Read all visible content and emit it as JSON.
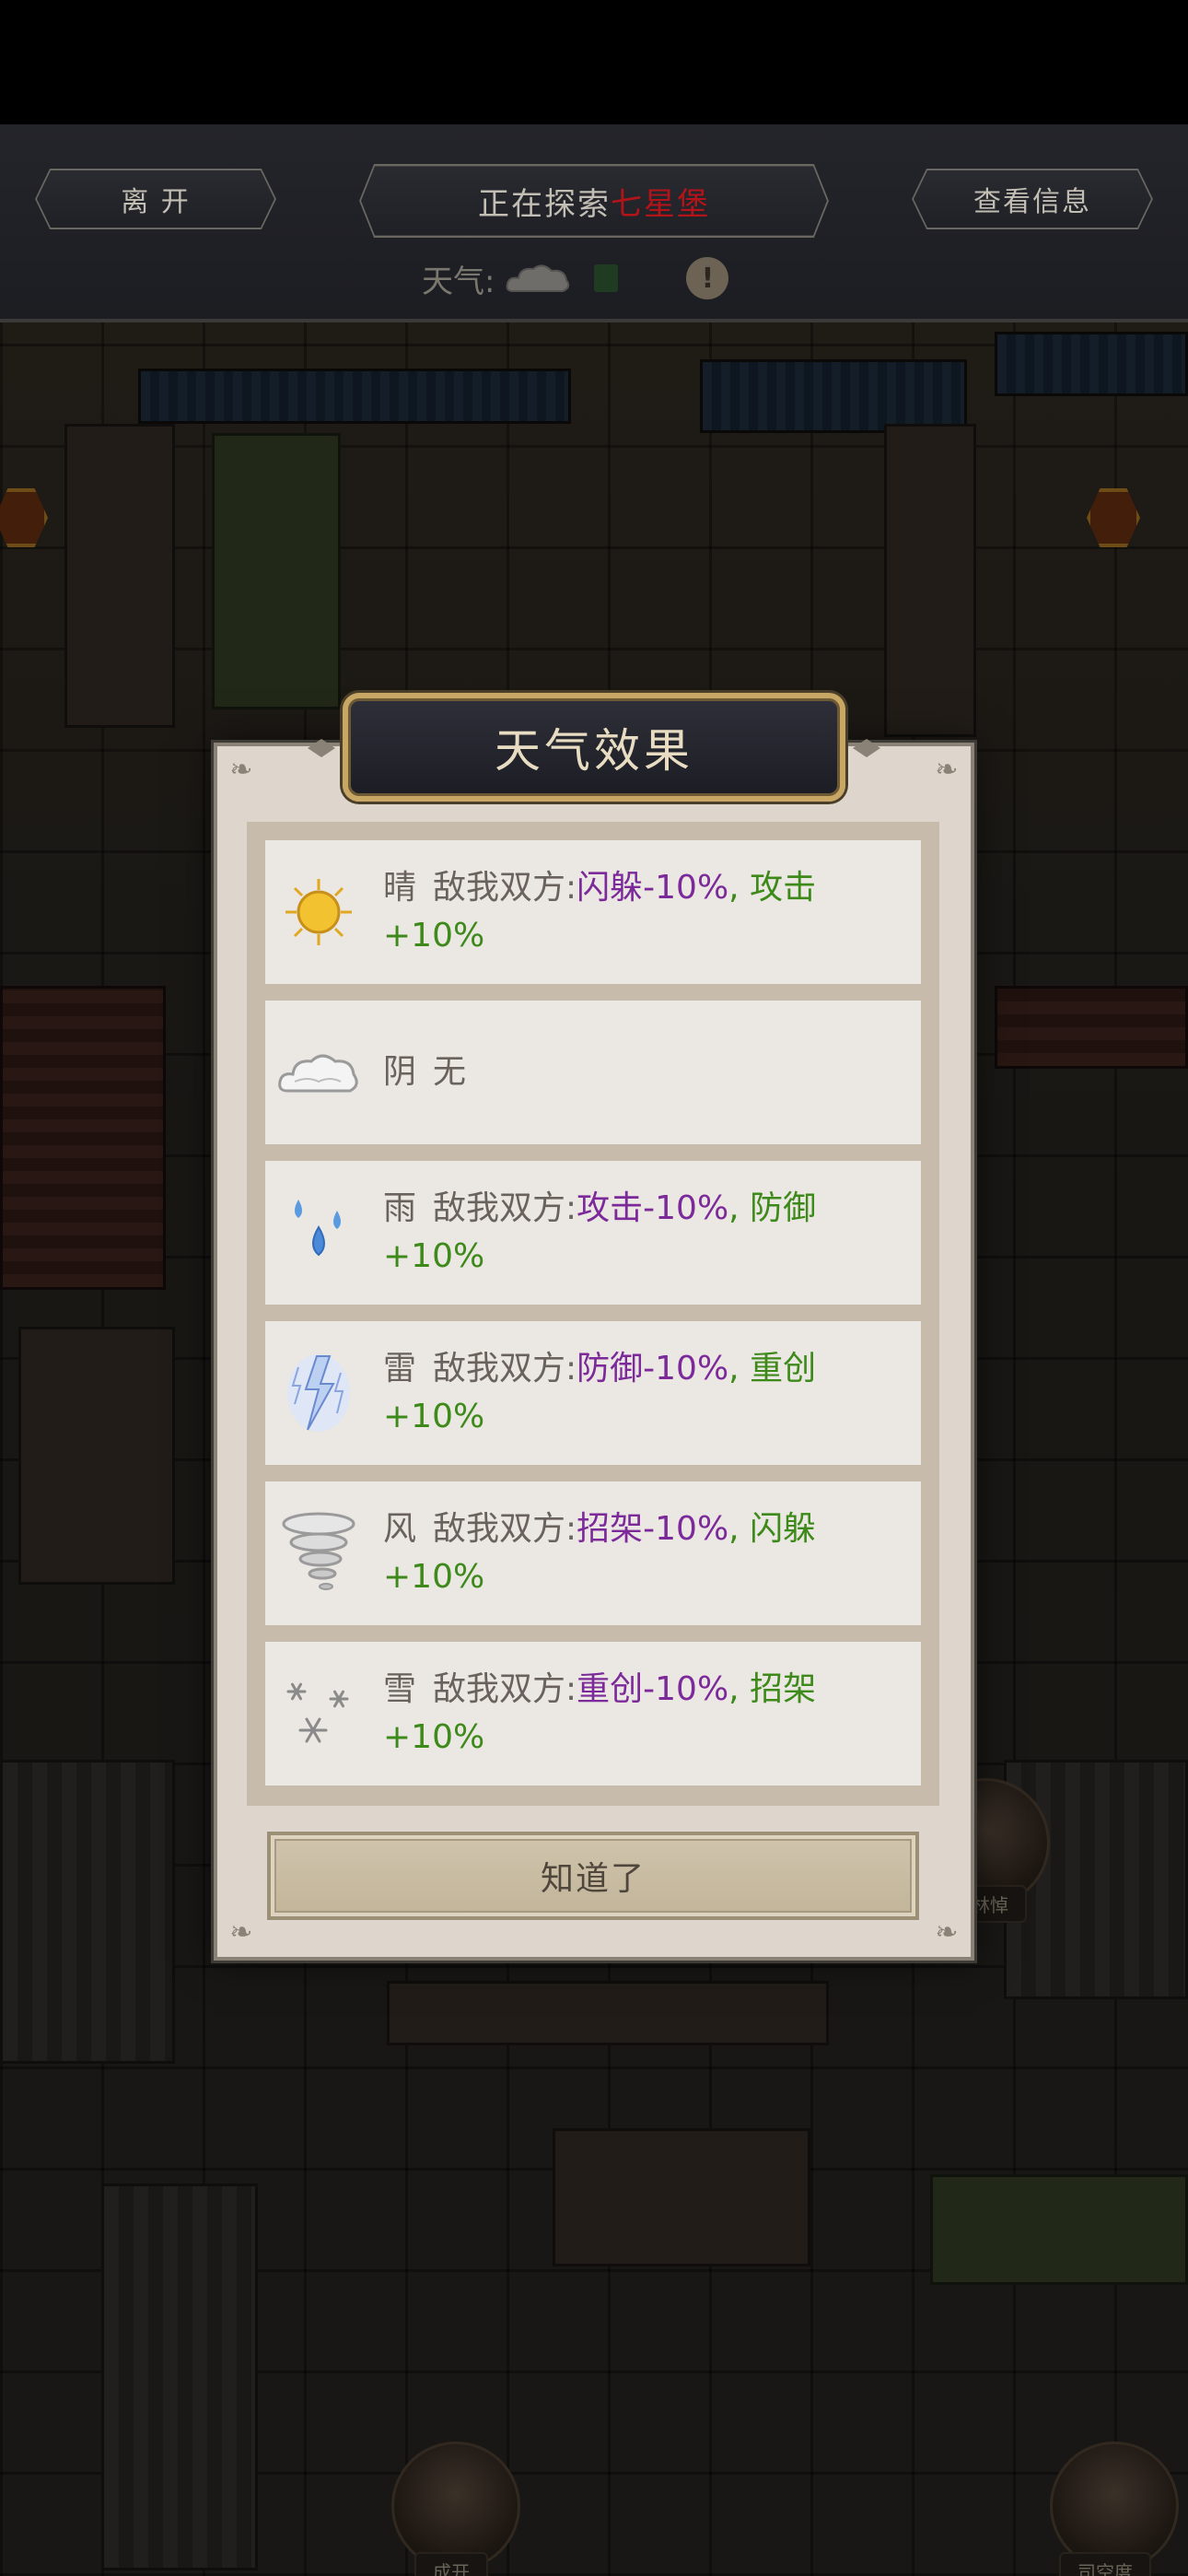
{
  "header": {
    "leave_label": "离 开",
    "exploring_prefix": "正在探索",
    "location_name": "七星堡",
    "info_label": "查看信息",
    "weather_label": "天气:",
    "current_weather_icon": "cloud-icon"
  },
  "map": {
    "character_tags": [
      "林悼",
      "成开",
      "司空度"
    ]
  },
  "dialog": {
    "title": "天气效果",
    "confirm_label": "知道了",
    "effects": [
      {
        "icon": "sun-icon",
        "name": "晴",
        "prefix": "敌我双方:",
        "neg": "闪躲-10%",
        "sep": ", ",
        "pos_a": "攻击",
        "pos_b": "+10%"
      },
      {
        "icon": "cloud-icon",
        "name": "阴",
        "plain": "无"
      },
      {
        "icon": "rain-icon",
        "name": "雨",
        "prefix": "敌我双方:",
        "neg": "攻击-10%",
        "sep": ", ",
        "pos_a": "防御",
        "pos_b": "+10%"
      },
      {
        "icon": "lightning-icon",
        "name": "雷",
        "prefix": "敌我双方:",
        "neg": "防御-10%",
        "sep": ", ",
        "pos_a": "重创",
        "pos_b": "+10%"
      },
      {
        "icon": "wind-icon",
        "name": "风",
        "prefix": "敌我双方:",
        "neg": "招架-10%",
        "sep": ", ",
        "pos_a": "闪躲",
        "pos_b": "+10%"
      },
      {
        "icon": "snow-icon",
        "name": "雪",
        "prefix": "敌我双方:",
        "neg": "重创-10%",
        "sep": ", ",
        "pos_a": "招架",
        "pos_b": "+10%"
      }
    ]
  },
  "colors": {
    "negative": "#7c2a9a",
    "positive": "#3d8a1a",
    "location": "#b3141a",
    "title_gold": "#c8a765"
  }
}
